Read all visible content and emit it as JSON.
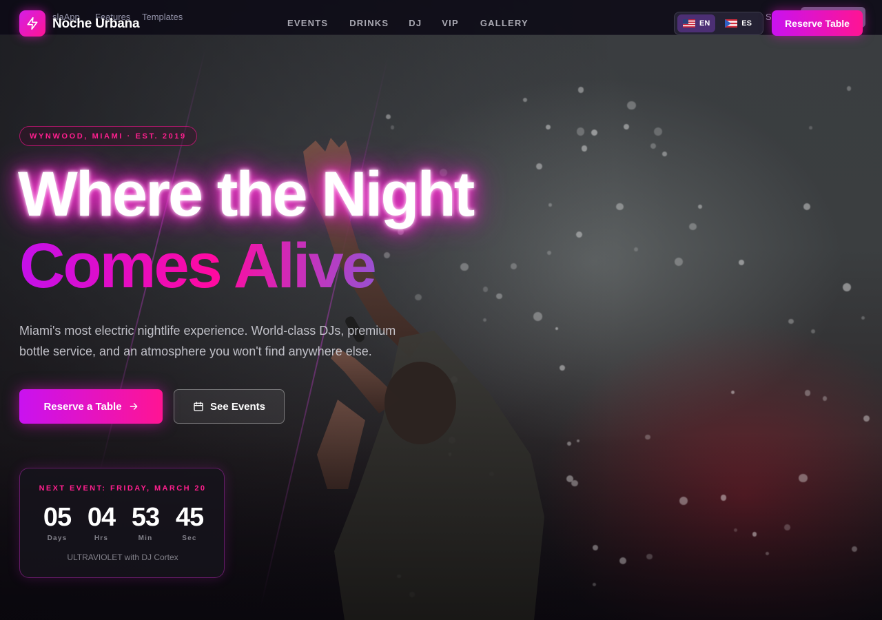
{
  "ghost": {
    "app_name": "slaApp",
    "features": "Features",
    "templates": "Templates",
    "s": "S"
  },
  "brand": {
    "logo_icon": "lightning-bolt-icon",
    "name": "Noche Urbana"
  },
  "nav": {
    "items": [
      {
        "label": "EVENTS"
      },
      {
        "label": "DRINKS"
      },
      {
        "label": "DJ"
      },
      {
        "label": "VIP"
      },
      {
        "label": "GALLERY"
      }
    ],
    "languages": [
      {
        "code": "EN",
        "flag": "us-flag-icon",
        "active": true
      },
      {
        "code": "ES",
        "flag": "pr-flag-icon",
        "active": false
      }
    ],
    "cta_label": "Reserve Table"
  },
  "hero": {
    "badge": "WYNWOOD, MIAMI · EST. 2019",
    "headline_line1": "Where the Night",
    "headline_line2": "Comes Alive",
    "subtext": "Miami's most electric nightlife experience. World-class DJs, premium bottle service, and an atmosphere you won't find anywhere else.",
    "primary_button": "Reserve a Table",
    "secondary_button": "See Events"
  },
  "countdown": {
    "label": "NEXT EVENT: FRIDAY, MARCH 20",
    "units": [
      {
        "value": "05",
        "caption": "Days"
      },
      {
        "value": "04",
        "caption": "Hrs"
      },
      {
        "value": "53",
        "caption": "Min"
      },
      {
        "value": "45",
        "caption": "Sec"
      }
    ],
    "event_name": "ULTRAVIOLET with DJ Cortex"
  },
  "colors": {
    "accent_magenta": "#ff1493",
    "accent_purple": "#c912f0",
    "background": "#0b0a10"
  }
}
